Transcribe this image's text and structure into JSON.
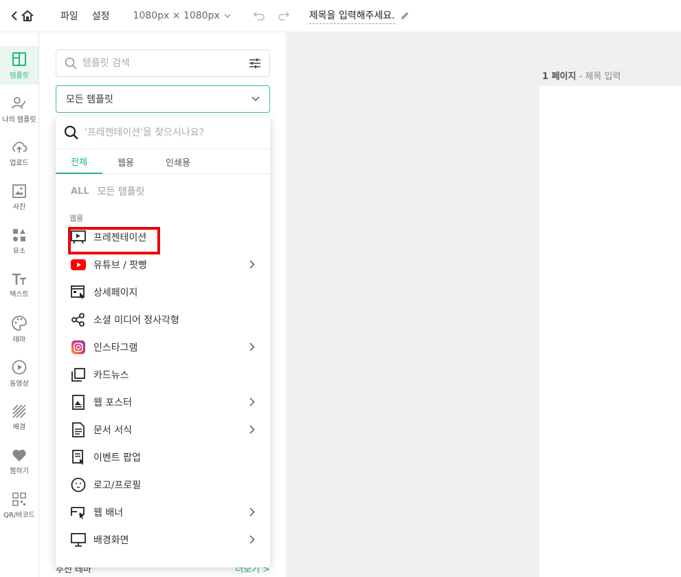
{
  "topbar": {
    "menu_file": "파일",
    "menu_settings": "설정",
    "size": "1080px × 1080px",
    "doc_title": "제목을 입력해주세요."
  },
  "rail": [
    {
      "label": "템플릿",
      "icon": "template-icon",
      "active": true
    },
    {
      "label": "나의 템플릿",
      "icon": "my-template-icon"
    },
    {
      "label": "업로드",
      "icon": "upload-icon"
    },
    {
      "label": "사진",
      "icon": "photo-icon"
    },
    {
      "label": "요소",
      "icon": "elements-icon"
    },
    {
      "label": "텍스트",
      "icon": "text-icon"
    },
    {
      "label": "테마",
      "icon": "palette-icon"
    },
    {
      "label": "동영상",
      "icon": "video-icon"
    },
    {
      "label": "배경",
      "icon": "background-icon"
    },
    {
      "label": "찜하기",
      "icon": "heart-icon"
    },
    {
      "label": "QR/바코드",
      "icon": "qr-icon"
    }
  ],
  "panel": {
    "search_placeholder": "템플릿 검색",
    "select_value": "모든 템플릿",
    "bottom_label": "추천 테마",
    "bottom_more": "더보기 >"
  },
  "dropdown": {
    "search_placeholder": "'프레젠테이션'을 찾으시나요?",
    "tabs": [
      "전체",
      "웹용",
      "인쇄용"
    ],
    "all_tag": "ALL",
    "all_label": "모든 템플릿",
    "group_label": "웹용",
    "items": [
      {
        "label": "프레젠테이션",
        "icon": "presentation-icon",
        "has_sub": false
      },
      {
        "label": "유튜브 / 팟빵",
        "icon": "youtube-icon",
        "has_sub": true
      },
      {
        "label": "상세페이지",
        "icon": "detail-page-icon",
        "has_sub": false
      },
      {
        "label": "소셜 미디어 정사각형",
        "icon": "share-icon",
        "has_sub": false
      },
      {
        "label": "인스타그램",
        "icon": "instagram-icon",
        "has_sub": true
      },
      {
        "label": "카드뉴스",
        "icon": "card-news-icon",
        "has_sub": false
      },
      {
        "label": "웹 포스터",
        "icon": "poster-icon",
        "has_sub": true
      },
      {
        "label": "문서 서식",
        "icon": "document-icon",
        "has_sub": true
      },
      {
        "label": "이벤트 팝업",
        "icon": "event-popup-icon",
        "has_sub": false
      },
      {
        "label": "로고/프로필",
        "icon": "logo-profile-icon",
        "has_sub": false
      },
      {
        "label": "웹 배너",
        "icon": "web-banner-icon",
        "has_sub": true
      },
      {
        "label": "배경화면",
        "icon": "monitor-icon",
        "has_sub": true
      }
    ]
  },
  "canvas": {
    "page_number": "1 페이지",
    "page_title": "- 제목 입력"
  },
  "colors": {
    "accent": "#22b573",
    "highlight": "#ee0000",
    "youtube": "#ff0000"
  }
}
